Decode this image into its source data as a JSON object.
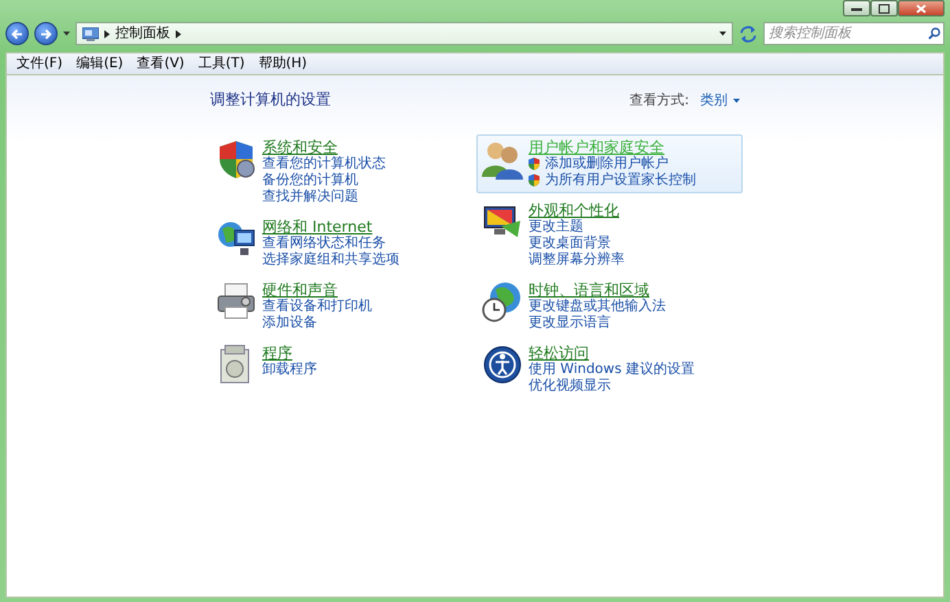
{
  "address_bar": {
    "breadcrumb": [
      "控制面板"
    ],
    "search": {
      "placeholder": "搜索控制面板"
    }
  },
  "menu": [
    "文件(F)",
    "编辑(E)",
    "查看(V)",
    "工具(T)",
    "帮助(H)"
  ],
  "heading": "调整计算机的设置",
  "view_by": {
    "label": "查看方式:",
    "value": "类别"
  },
  "columns": [
    [
      {
        "title": "系统和安全",
        "highlighted": false,
        "links": [
          {
            "text": "查看您的计算机状态",
            "shield": false
          },
          {
            "text": "备份您的计算机",
            "shield": false
          },
          {
            "text": "查找并解决问题",
            "shield": false
          }
        ]
      },
      {
        "title": "网络和 Internet",
        "highlighted": false,
        "links": [
          {
            "text": "查看网络状态和任务",
            "shield": false
          },
          {
            "text": "选择家庭组和共享选项",
            "shield": false
          }
        ]
      },
      {
        "title": "硬件和声音",
        "highlighted": false,
        "links": [
          {
            "text": "查看设备和打印机",
            "shield": false
          },
          {
            "text": "添加设备",
            "shield": false
          }
        ]
      },
      {
        "title": "程序",
        "highlighted": false,
        "links": [
          {
            "text": "卸载程序",
            "shield": false
          }
        ]
      }
    ],
    [
      {
        "title": "用户帐户和家庭安全",
        "highlighted": true,
        "links": [
          {
            "text": "添加或删除用户帐户",
            "shield": true
          },
          {
            "text": "为所有用户设置家长控制",
            "shield": true
          }
        ]
      },
      {
        "title": "外观和个性化",
        "highlighted": false,
        "links": [
          {
            "text": "更改主题",
            "shield": false
          },
          {
            "text": "更改桌面背景",
            "shield": false
          },
          {
            "text": "调整屏幕分辨率",
            "shield": false
          }
        ]
      },
      {
        "title": "时钟、语言和区域",
        "highlighted": false,
        "links": [
          {
            "text": "更改键盘或其他输入法",
            "shield": false
          },
          {
            "text": "更改显示语言",
            "shield": false
          }
        ]
      },
      {
        "title": "轻松访问",
        "highlighted": false,
        "links": [
          {
            "text": "使用 Windows 建议的设置",
            "shield": false
          },
          {
            "text": "优化视频显示",
            "shield": false
          }
        ]
      }
    ]
  ]
}
